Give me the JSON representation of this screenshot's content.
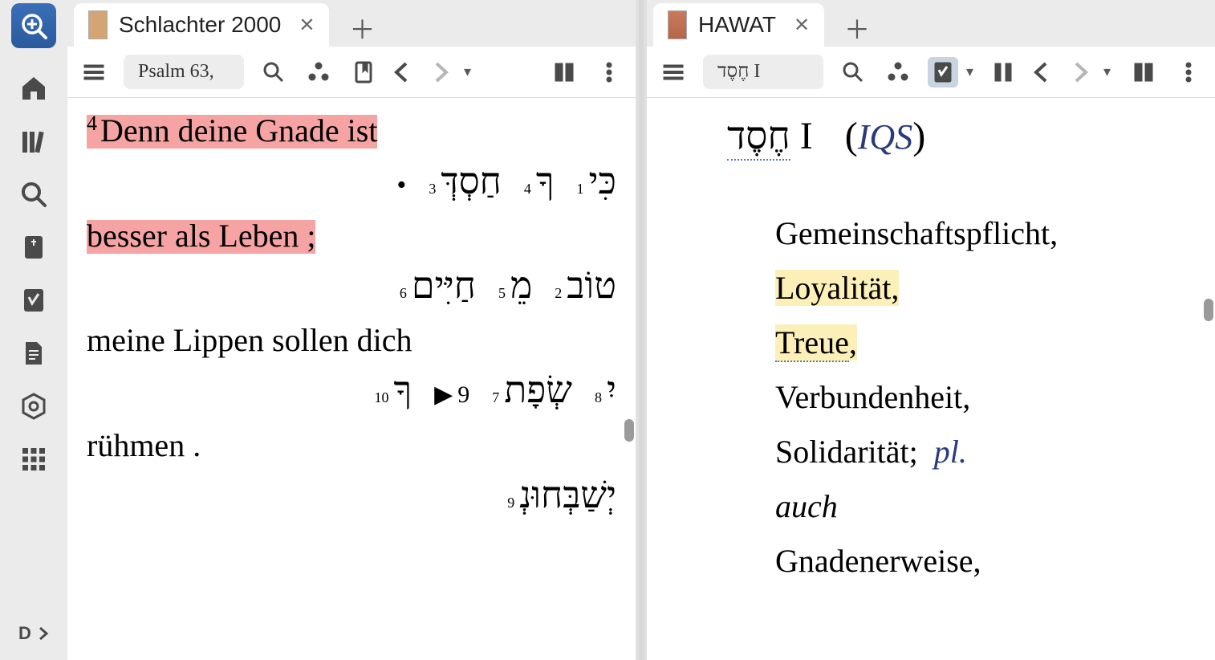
{
  "sidebar": {
    "bottom_label": "D"
  },
  "left_pane": {
    "tab_title": "Schlachter 2000",
    "reference": "Psalm 63,",
    "verse_num": "4",
    "line1_de": "Denn deine Gnade ist",
    "line1_heb": [
      {
        "n": "1",
        "t": "כִּי"
      },
      {
        "n": "4",
        "t": "ךָ"
      },
      {
        "n": "3",
        "t": "חַסְדְּ"
      }
    ],
    "bullet": "•",
    "line2_de": "besser als Leben ;",
    "line2_heb": [
      {
        "n": "2",
        "t": "טוֹב"
      },
      {
        "n": "5",
        "t": "מֵ"
      },
      {
        "n": "6",
        "t": "חַיִּים"
      }
    ],
    "line3_de": "meine Lippen sollen dich",
    "line3_heb_a": [
      {
        "n": "8",
        "t": "יִ"
      },
      {
        "n": "7",
        "t": "שְׂפָת"
      }
    ],
    "line3_tri": "▶",
    "line3_tri_n": "9",
    "line3_heb_b": {
      "n": "10",
      "t": "ךָ"
    },
    "line4_de": "rühmen .",
    "line4_heb": {
      "n": "9",
      "t": "יְשַׁבְּחוּנְ"
    }
  },
  "right_pane": {
    "tab_title": "HAWAT",
    "reference": "חֶסֶד I",
    "headword_heb": "חֶסֶד",
    "headword_rom": "I",
    "headword_ref": "IQS",
    "defs": {
      "d1": "Gemeinschaftspflicht,",
      "d2": "Loyalität",
      "d2p": ",",
      "d3": "Treue",
      "d3p": ",",
      "d4": "Verbundenheit,",
      "d5a": "Solidarität;",
      "d5b": "pl.",
      "d6": "auch",
      "d7": "Gnadenerweise,"
    }
  }
}
